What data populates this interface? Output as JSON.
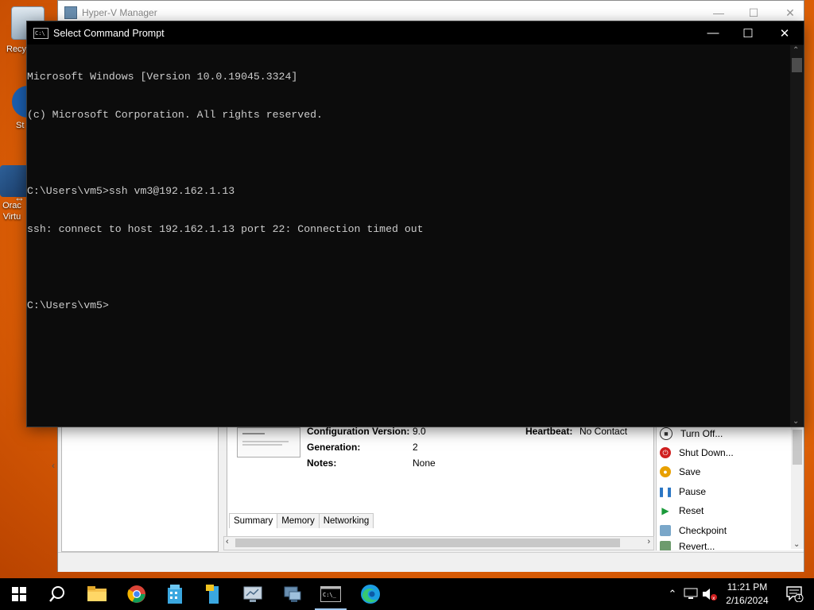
{
  "desktop": {
    "icons": [
      {
        "label": "Recy"
      },
      {
        "label": "St"
      },
      {
        "label": "Orac Virtu"
      }
    ]
  },
  "hyperv": {
    "title": "Hyper-V Manager",
    "props": {
      "config_version_label": "Configuration Version:",
      "config_version_value": "9.0",
      "generation_label": "Generation:",
      "generation_value": "2",
      "notes_label": "Notes:",
      "notes_value": "None",
      "heartbeat_label": "Heartbeat:",
      "heartbeat_value": "No Contact"
    },
    "tabs": [
      "Summary",
      "Memory",
      "Networking"
    ],
    "actions": [
      "Turn Off...",
      "Shut Down...",
      "Save",
      "Pause",
      "Reset",
      "Checkpoint",
      "Revert..."
    ]
  },
  "cmd": {
    "title": "Select Command Prompt",
    "lines": [
      "Microsoft Windows [Version 10.0.19045.3324]",
      "(c) Microsoft Corporation. All rights reserved.",
      "",
      "C:\\Users\\vm5>ssh vm3@192.162.1.13",
      "ssh: connect to host 192.162.1.13 port 22: Connection timed out",
      "",
      "C:\\Users\\vm5>"
    ]
  },
  "taskbar": {
    "time": "11:21 PM",
    "date": "2/16/2024",
    "notification_count": "1"
  },
  "colors": {
    "cmd_bg": "#0c0c0c",
    "cmd_text": "#cccccc",
    "desktop_orange": "#e8630a",
    "taskbar": "#000000"
  }
}
